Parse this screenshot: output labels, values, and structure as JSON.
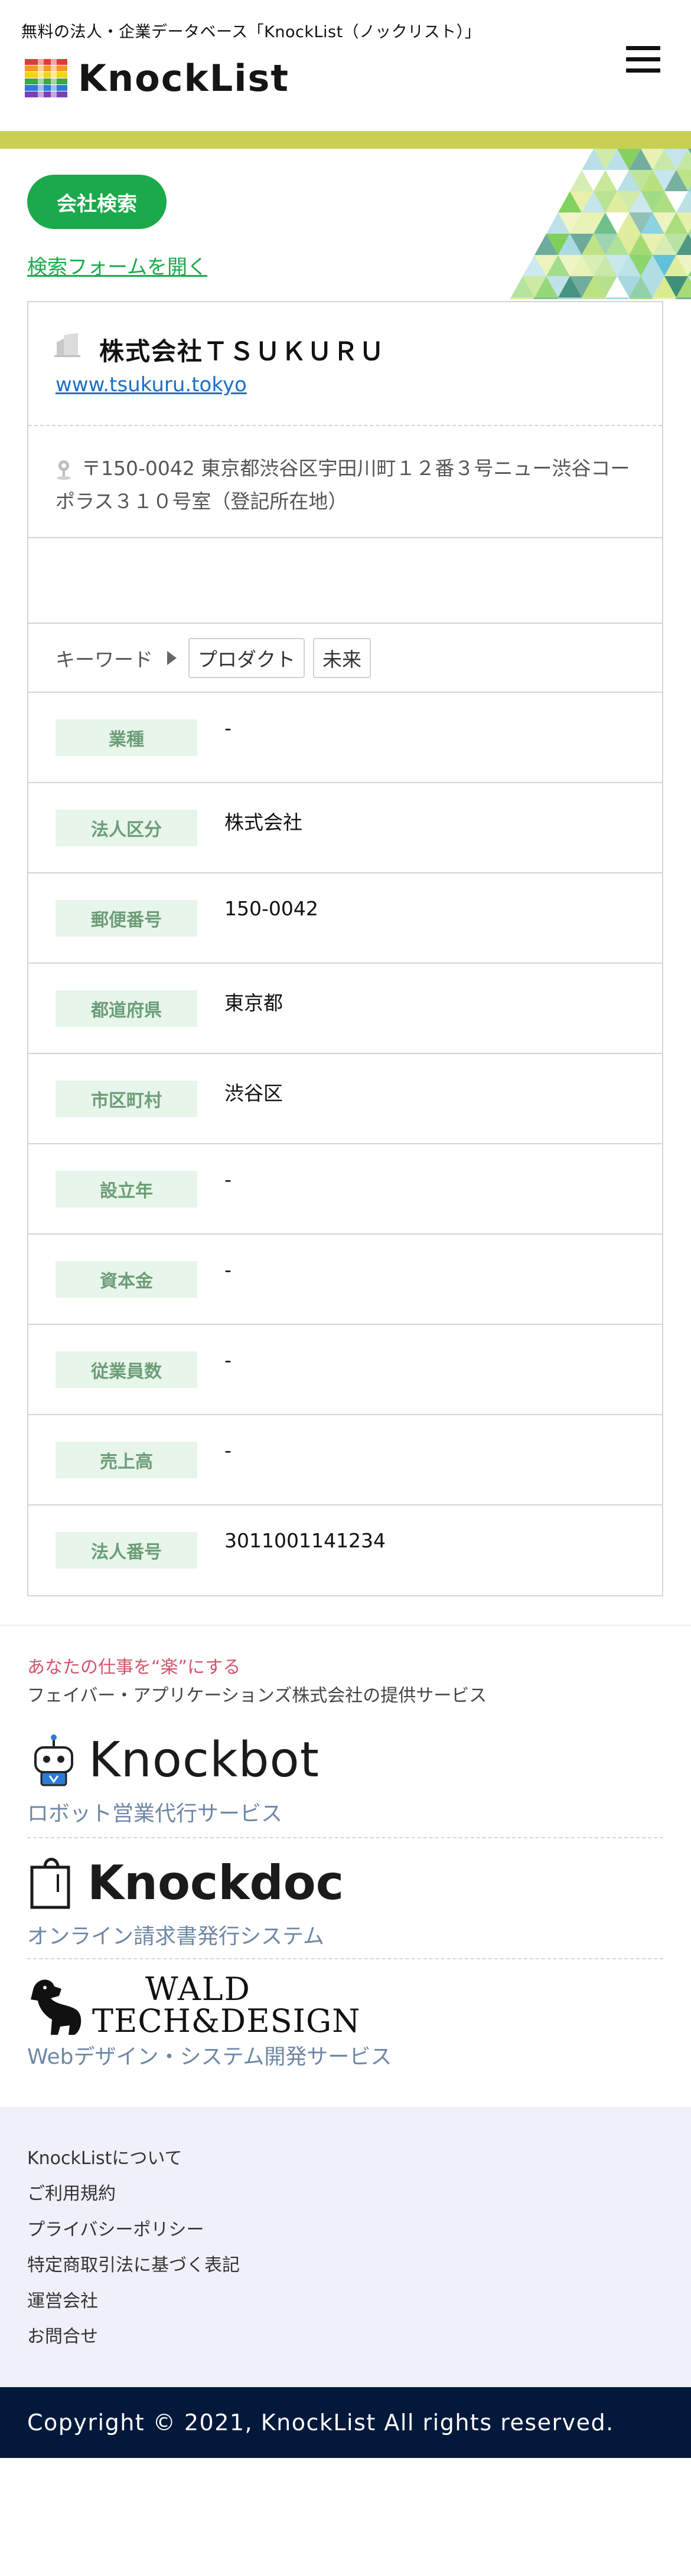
{
  "header": {
    "tagline": "無料の法人・企業データベース「KnockList（ノックリスト）」",
    "logo_text": "KnockList",
    "accent_color": "#c9cf52"
  },
  "main": {
    "search_button_label": "会社検索",
    "open_form_link": "検索フォームを開く",
    "company": {
      "name": "株式会社ＴＳＵＫＵＲＵ",
      "url": "www.tsukuru.tokyo",
      "address": "〒150-0042 東京都渋谷区宇田川町１２番３号ニュー渋谷コーポラス３１０号室（登記所在地）"
    },
    "keywords": {
      "label": "キーワード",
      "tags": [
        "プロダクト",
        "未来"
      ]
    },
    "info_rows": [
      {
        "label": "業種",
        "value": "-"
      },
      {
        "label": "法人区分",
        "value": "株式会社"
      },
      {
        "label": "郵便番号",
        "value": "150-0042"
      },
      {
        "label": "都道府県",
        "value": "東京都"
      },
      {
        "label": "市区町村",
        "value": "渋谷区"
      },
      {
        "label": "設立年",
        "value": "-"
      },
      {
        "label": "資本金",
        "value": "-"
      },
      {
        "label": "従業員数",
        "value": "-"
      },
      {
        "label": "売上高",
        "value": "-"
      },
      {
        "label": "法人番号",
        "value": "3011001141234"
      }
    ],
    "brand_color": "#1ba94c"
  },
  "services": {
    "catch": "あなたの仕事を“楽”にする",
    "provider": "フェイバー・アプリケーションズ株式会社の提供サービス",
    "items": [
      {
        "logo_text": "Knockbot",
        "description": "ロボット営業代行サービス",
        "icon": "robot-icon"
      },
      {
        "logo_text": "Knockdoc",
        "description": "オンライン請求書発行システム",
        "icon": "document-icon"
      },
      {
        "logo_text_line1": "WALD",
        "logo_text_line2": "TECH&DESIGN",
        "description": "Webデザイン・システム開発サービス",
        "icon": "dog-icon"
      }
    ]
  },
  "footer": {
    "links": [
      "KnockListについて",
      "ご利用規約",
      "プライバシーポリシー",
      "特定商取引法に基づく表記",
      "運営会社",
      "お問合せ"
    ],
    "copyright": "Copyright © 2021, KnockList All rights reserved."
  }
}
